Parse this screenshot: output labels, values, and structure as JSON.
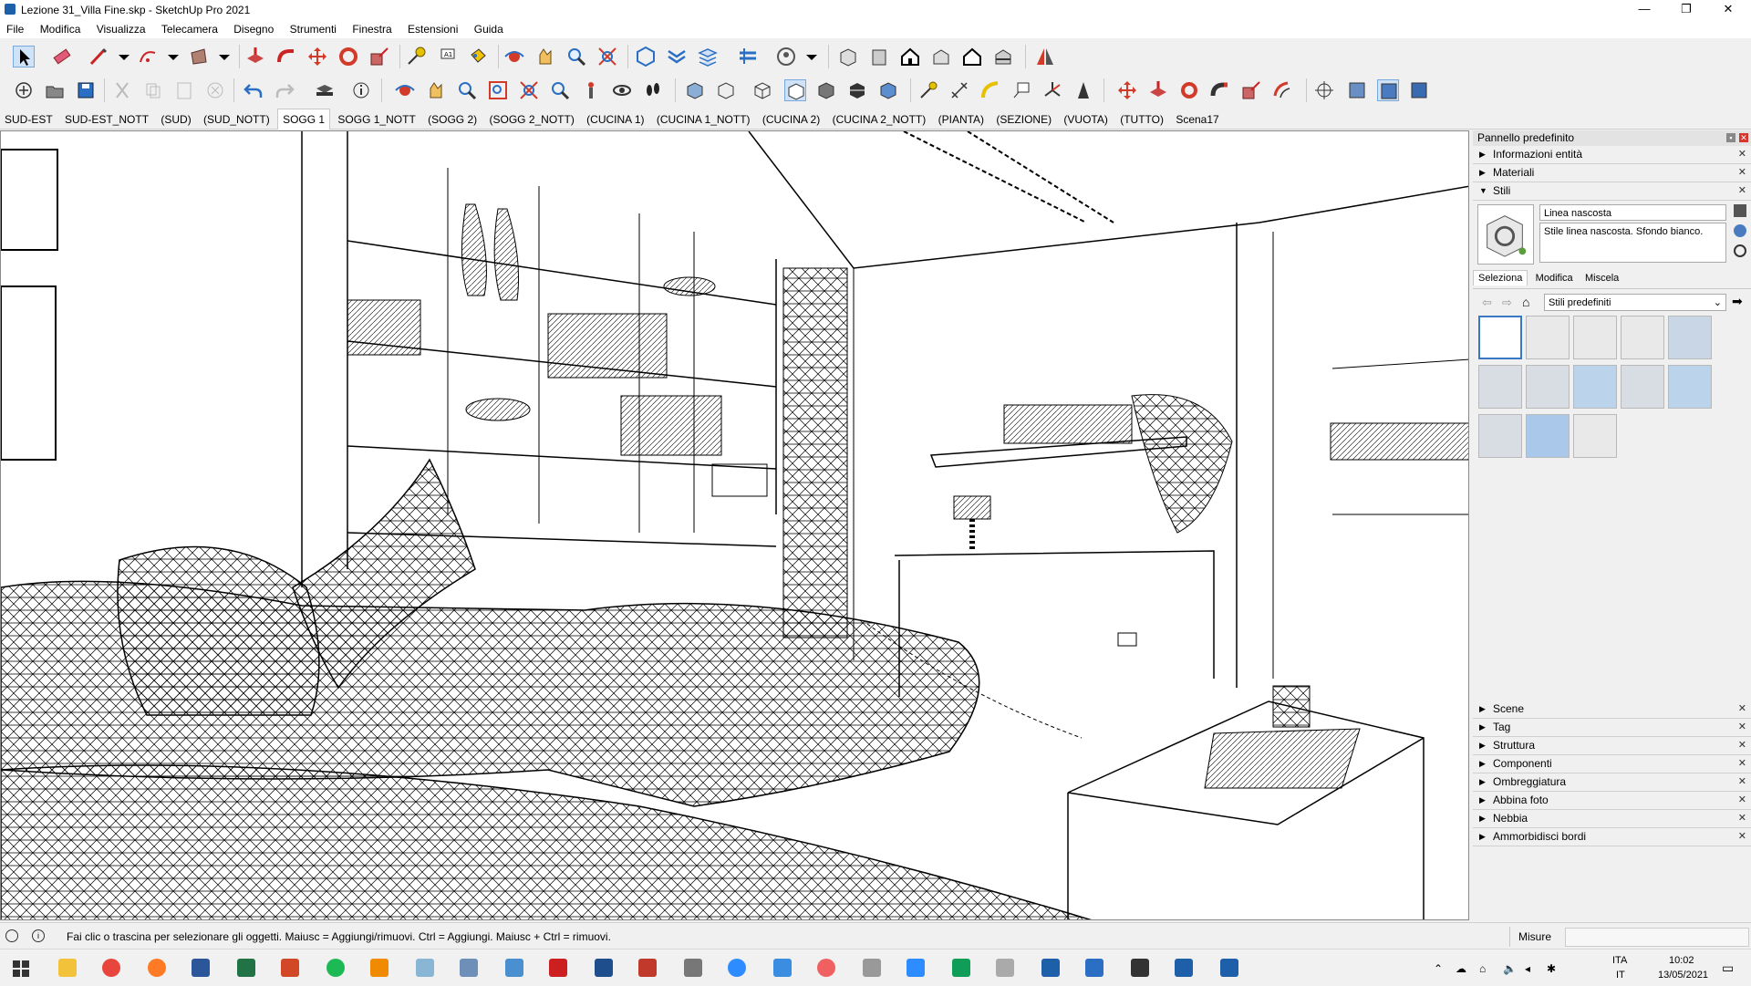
{
  "window": {
    "title": "Lezione 31_Villa Fine.skp - SketchUp Pro 2021"
  },
  "menu": [
    "File",
    "Modifica",
    "Visualizza",
    "Telecamera",
    "Disegno",
    "Strumenti",
    "Finestra",
    "Estensioni",
    "Guida"
  ],
  "scenes": [
    "SUD-EST",
    "SUD-EST_NOTT",
    "(SUD)",
    "(SUD_NOTT)",
    "SOGG 1",
    "SOGG 1_NOTT",
    "(SOGG 2)",
    "(SOGG 2_NOTT)",
    "(CUCINA 1)",
    "(CUCINA 1_NOTT)",
    "(CUCINA 2)",
    "(CUCINA 2_NOTT)",
    "(PIANTA)",
    "(SEZIONE)",
    "(VUOTA)",
    "(TUTTO)",
    "Scena17"
  ],
  "active_scene": "SOGG 1",
  "panel": {
    "title": "Pannello predefinito",
    "trays_top": [
      "Informazioni entità",
      "Materiali"
    ],
    "styles": {
      "label": "Stili",
      "style_name": "Linea nascosta",
      "style_description": "Stile linea nascosta. Sfondo bianco.",
      "tabs": [
        "Seleziona",
        "Modifica",
        "Miscela"
      ],
      "active_tab": "Seleziona",
      "collection": "Stili predefiniti"
    },
    "trays_bottom": [
      "Scene",
      "Tag",
      "Struttura",
      "Componenti",
      "Ombreggiatura",
      "Abbina foto",
      "Nebbia",
      "Ammorbidisci bordi"
    ]
  },
  "status": {
    "message": "Fai clic o trascina per selezionare gli oggetti. Maiusc = Aggiungi/rimuovi. Ctrl = Aggiungi. Maiusc + Ctrl = rimuovi.",
    "measurements_label": "Misure"
  },
  "taskbar": {
    "lang1": "ITA",
    "lang2": "IT",
    "time": "10:02",
    "date": "13/05/2021"
  },
  "colors": {
    "accent_red": "#d23a2a",
    "accent_blue": "#2f6fbf",
    "selection": "#3a78c4"
  }
}
